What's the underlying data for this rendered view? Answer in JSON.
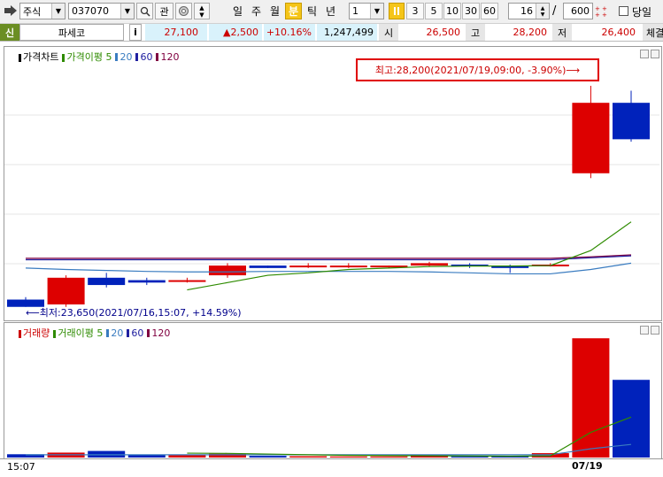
{
  "toolbar": {
    "market": "주식",
    "code": "037070",
    "btn_inquiry": "관",
    "periods": [
      "일",
      "주",
      "월",
      "분",
      "틱",
      "년"
    ],
    "active_period": "분",
    "interval_value": "1",
    "minute_buttons": [
      "3",
      "5",
      "10",
      "30",
      "60"
    ],
    "active_minute": "1",
    "count_value": "16",
    "slash": "/",
    "total_value": "600",
    "sameday_label": "당일"
  },
  "quote": {
    "market_tag": "신",
    "name": "파세코",
    "info_icon": "i",
    "price": "27,100",
    "change": "▲2,500",
    "change_rate": "+10.16%",
    "volume": "1,247,499",
    "open_label": "시",
    "open": "26,500",
    "high_label": "고",
    "high": "28,200",
    "low_label": "저",
    "low": "26,400",
    "extra_label": "체결강"
  },
  "price_panel": {
    "legend": [
      {
        "label": "가격차트",
        "color": "#000000"
      },
      {
        "label": "가격이평 5",
        "color": "#2e8b00"
      },
      {
        "label": "20",
        "color": "#3a7cc0"
      },
      {
        "label": "60",
        "color": "#2020a0"
      },
      {
        "label": "120",
        "color": "#800040"
      }
    ],
    "high_annotation": "최고:28,200(2021/07/19,09:00, -3.90%)⟶",
    "low_annotation": "⟵최저:23,650(2021/07/16,15:07, +14.59%)"
  },
  "volume_panel": {
    "legend": [
      {
        "label": "거래량",
        "color": "#cc0000"
      },
      {
        "label": "거래이평 5",
        "color": "#2e8b00"
      },
      {
        "label": "20",
        "color": "#3a7cc0"
      },
      {
        "label": "60",
        "color": "#2020a0"
      },
      {
        "label": "120",
        "color": "#800040"
      }
    ]
  },
  "time_axis": {
    "left_label": "15:07",
    "date_label": "07/19"
  },
  "colors": {
    "up": "#dd0000",
    "down": "#0022bb",
    "ma5": "#2e8b00",
    "ma20": "#3a7cc0",
    "ma60": "#2020a0",
    "ma120": "#800040",
    "highlight": "#ff0000"
  },
  "chart_data": {
    "type": "candlestick",
    "candles": [
      {
        "o": 23800,
        "c": 23650,
        "h": 23850,
        "l": 23650
      },
      {
        "o": 23700,
        "c": 24250,
        "h": 24300,
        "l": 23650
      },
      {
        "o": 24250,
        "c": 24100,
        "h": 24350,
        "l": 24050
      },
      {
        "o": 24200,
        "c": 24150,
        "h": 24250,
        "l": 24100
      },
      {
        "o": 24200,
        "c": 24200,
        "h": 24250,
        "l": 24150
      },
      {
        "o": 24300,
        "c": 24500,
        "h": 24550,
        "l": 24250
      },
      {
        "o": 24500,
        "c": 24450,
        "h": 24500,
        "l": 24450
      },
      {
        "o": 24500,
        "c": 24500,
        "h": 24550,
        "l": 24450
      },
      {
        "o": 24500,
        "c": 24500,
        "h": 24550,
        "l": 24450
      },
      {
        "o": 24500,
        "c": 24500,
        "h": 24500,
        "l": 24450
      },
      {
        "o": 24500,
        "c": 24550,
        "h": 24580,
        "l": 24480
      },
      {
        "o": 24520,
        "c": 24500,
        "h": 24550,
        "l": 24450
      },
      {
        "o": 24500,
        "c": 24450,
        "h": 24520,
        "l": 24350
      },
      {
        "o": 24500,
        "c": 24520,
        "h": 24550,
        "l": 24480
      },
      {
        "o": 26400,
        "c": 27850,
        "h": 28200,
        "l": 26300
      },
      {
        "o": 27850,
        "c": 27100,
        "h": 28100,
        "l": 27050
      }
    ],
    "ma5": [
      null,
      null,
      null,
      null,
      24000,
      24150,
      24300,
      24350,
      24420,
      24450,
      24480,
      24490,
      24490,
      24500,
      24810,
      25400
    ],
    "ma20": [
      24450,
      24420,
      24400,
      24380,
      24370,
      24370,
      24380,
      24380,
      24380,
      24380,
      24370,
      24350,
      24330,
      24330,
      24420,
      24550
    ],
    "ma60": [
      24620,
      24620,
      24620,
      24620,
      24620,
      24620,
      24620,
      24620,
      24620,
      24620,
      24620,
      24620,
      24620,
      24620,
      24660,
      24700
    ],
    "ma120": [
      24650,
      24650,
      24650,
      24650,
      24650,
      24650,
      24650,
      24650,
      24650,
      24650,
      24650,
      24650,
      24650,
      24650,
      24680,
      24720
    ],
    "volume": [
      30000,
      45000,
      60000,
      25000,
      20000,
      35000,
      15000,
      12000,
      10000,
      10000,
      15000,
      10000,
      12000,
      40000,
      1090000,
      710000
    ],
    "vol_ma5": [
      null,
      null,
      null,
      null,
      40000,
      38000,
      32000,
      25000,
      20000,
      18000,
      16000,
      14000,
      12000,
      15000,
      230000,
      370000
    ],
    "vol_ma20": [
      25000,
      25000,
      25000,
      25000,
      25000,
      25000,
      25000,
      25000,
      25000,
      25000,
      25000,
      25000,
      25000,
      25000,
      80000,
      120000
    ],
    "ylim": [
      23500,
      28600
    ],
    "vol_ylim": [
      0,
      1100000
    ]
  }
}
